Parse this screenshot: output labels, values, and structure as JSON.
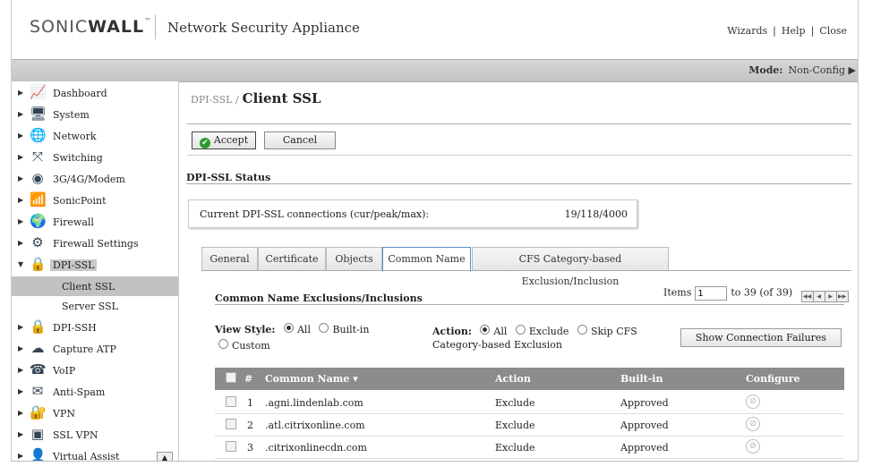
{
  "header": {
    "logo_sonic": "SONIC",
    "logo_wall": "WALL",
    "product": "Network Security Appliance",
    "links": [
      "Wizards",
      "Help",
      "Close"
    ]
  },
  "modebar": {
    "label": "Mode:",
    "value": "Non-Config"
  },
  "sidebar": {
    "items": [
      {
        "label": "Dashboard",
        "icon": "dashboard-icon",
        "glyph": "📈"
      },
      {
        "label": "System",
        "icon": "system-icon",
        "glyph": "🖥"
      },
      {
        "label": "Network",
        "icon": "network-icon",
        "glyph": "🌐"
      },
      {
        "label": "Switching",
        "icon": "switching-icon",
        "glyph": "⤧"
      },
      {
        "label": "3G/4G/Modem",
        "icon": "modem-icon",
        "glyph": "◉"
      },
      {
        "label": "SonicPoint",
        "icon": "sonicpoint-icon",
        "glyph": "📶"
      },
      {
        "label": "Firewall",
        "icon": "firewall-icon",
        "glyph": "🌍"
      },
      {
        "label": "Firewall Settings",
        "icon": "firewall-settings-icon",
        "glyph": "⚙"
      },
      {
        "label": "DPI-SSL",
        "icon": "dpi-ssl-icon",
        "glyph": "🔒"
      }
    ],
    "subitems": [
      "Client SSL",
      "Server SSL"
    ],
    "items_after": [
      {
        "label": "DPI-SSH",
        "icon": "dpi-ssh-icon",
        "glyph": "🔒"
      },
      {
        "label": "Capture ATP",
        "icon": "capture-atp-icon",
        "glyph": "☁"
      },
      {
        "label": "VoIP",
        "icon": "voip-icon",
        "glyph": "☎"
      },
      {
        "label": "Anti-Spam",
        "icon": "anti-spam-icon",
        "glyph": "✉"
      },
      {
        "label": "VPN",
        "icon": "vpn-icon",
        "glyph": "🔐"
      },
      {
        "label": "SSL VPN",
        "icon": "ssl-vpn-icon",
        "glyph": "▣"
      },
      {
        "label": "Virtual Assist",
        "icon": "virtual-assist-icon",
        "glyph": "👤"
      }
    ]
  },
  "breadcrumb": {
    "parent": "DPI-SSL /",
    "title": "Client SSL"
  },
  "buttons": {
    "accept": "Accept",
    "cancel": "Cancel"
  },
  "status": {
    "title": "DPI-SSL Status",
    "label": "Current DPI-SSL connections (cur/peak/max):",
    "value": "19/118/4000"
  },
  "tabs": [
    "General",
    "Certificate",
    "Objects",
    "Common Name",
    "CFS Category-based Exclusion/Inclusion"
  ],
  "cn": {
    "title": "Common Name Exclusions/Inclusions",
    "items_label": "Items",
    "items_value": "1",
    "items_range": "to 39 (of 39)"
  },
  "view_style": {
    "label": "View Style:",
    "options": [
      "All",
      "Built-in",
      "Custom"
    ],
    "selected": "All"
  },
  "action_filter": {
    "label": "Action:",
    "options": [
      "All",
      "Exclude",
      "Skip CFS"
    ],
    "suffix": "Category-based Exclusion",
    "selected": "All"
  },
  "show_failures": "Show Connection Failures",
  "table": {
    "headers": {
      "num": "#",
      "name": "Common Name",
      "action": "Action",
      "builtin": "Built-in",
      "configure": "Configure"
    },
    "rows": [
      {
        "num": "1",
        "name": ".agni.lindenlab.com",
        "action": "Exclude",
        "builtin": "Approved"
      },
      {
        "num": "2",
        "name": ".atl.citrixonline.com",
        "action": "Exclude",
        "builtin": "Approved"
      },
      {
        "num": "3",
        "name": ".citrixonlinecdn.com",
        "action": "Exclude",
        "builtin": "Approved"
      }
    ]
  }
}
